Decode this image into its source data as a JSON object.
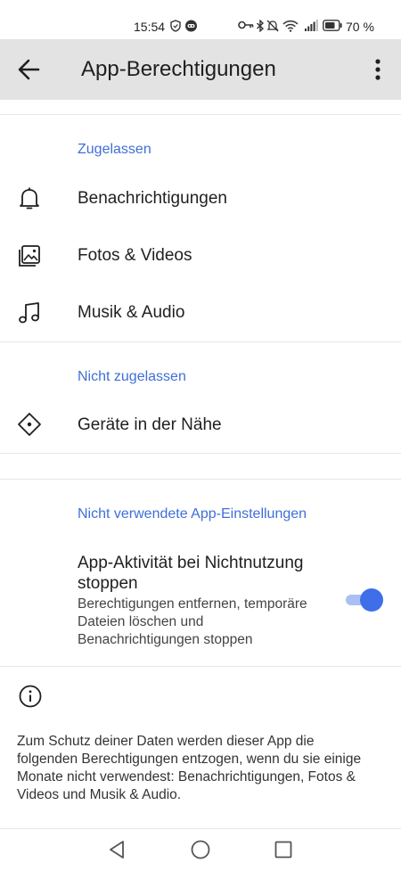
{
  "status_bar": {
    "time": "15:54",
    "battery_percent": "70 %",
    "icons": [
      "shield-icon",
      "notification-bot-icon",
      "key-icon",
      "bluetooth-icon",
      "mute-icon",
      "wifi-icon",
      "signal-icon",
      "battery-icon"
    ]
  },
  "app_bar": {
    "title": "App-Berechtigungen",
    "back_icon": "arrow-back-icon",
    "more_icon": "more-vert-icon",
    "background": "#e3e3e3"
  },
  "sections": {
    "allowed": {
      "header": "Zugelassen",
      "items": [
        {
          "label": "Benachrichtigungen",
          "icon": "bell-icon"
        },
        {
          "label": "Fotos & Videos",
          "icon": "photos-icon"
        },
        {
          "label": "Musik & Audio",
          "icon": "music-note-icon"
        }
      ]
    },
    "not_allowed": {
      "header": "Nicht zugelassen",
      "items": [
        {
          "label": "Geräte in der Nähe",
          "icon": "nearby-devices-icon"
        }
      ]
    },
    "unused": {
      "header": "Nicht verwendete App-Einstellungen",
      "setting_title": "App-Aktivität bei Nichtnutzung stoppen",
      "setting_description": "Berechtigungen entfernen, temporäre Dateien löschen und Benachrichtigungen stoppen",
      "toggle_on": true
    }
  },
  "footer_info": {
    "icon": "info-icon",
    "text": "Zum Schutz deiner Daten werden dieser App die folgenden Berechtigungen entzogen, wenn du sie einige Monate nicht verwendest: Benachrichtigungen, Fotos & Videos und Musik & Audio."
  },
  "nav_bar": {
    "buttons": [
      "back-triangle-icon",
      "home-circle-icon",
      "recents-square-icon"
    ]
  },
  "colors": {
    "accent": "#3f6fd8",
    "toggle_thumb": "#3f6fe8",
    "toggle_track": "#a9c0f3"
  }
}
